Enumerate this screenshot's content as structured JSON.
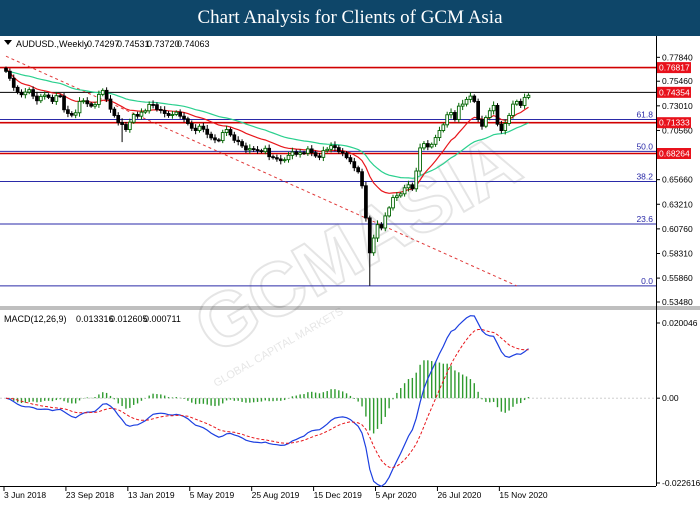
{
  "header": {
    "title": "Chart Analysis for Clients of GCM Asia"
  },
  "watermark": {
    "brand": "GCMASIA",
    "tagline": "GLOBAL CAPITAL MARKETS"
  },
  "colors": {
    "bullish": "#006400",
    "bearish": "#000000",
    "ema_fast": "#e8161b",
    "ema_slow": "#2ad08e",
    "sr_line": "#d10000",
    "fib_line": "#2a2aa8",
    "trendline": "#e03a3a",
    "macd_line": "#1c3fe0",
    "signal_line": "#e8161b",
    "histogram": "#2e9a2e",
    "price_label_bg": "#e8111b"
  },
  "chart_data": [
    {
      "type": "candlestick",
      "title": "AUDUSD.,Weekly",
      "ohlc": {
        "open": "0.74297",
        "high": "0.74531",
        "low": "0.73720",
        "close": "0.74063"
      },
      "x_labels": [
        "3 Jun 2018",
        "23 Sep 2018",
        "13 Jan 2019",
        "5 May 2019",
        "25 Aug 2019",
        "15 Dec 2019",
        "5 Apr 2020",
        "26 Jul 2020",
        "15 Nov 2020"
      ],
      "y_ticks": [
        "0.77840",
        "0.75460",
        "0.73010",
        "0.70560",
        "0.65660",
        "0.63210",
        "0.60760",
        "0.58310",
        "0.55860",
        "0.53480"
      ],
      "y_range": [
        0.5348,
        0.7837
      ],
      "resistance_levels": [
        {
          "value": 0.76817,
          "label": "0.76817"
        },
        {
          "value": 0.71333,
          "label": "0.71333"
        },
        {
          "value": 0.68264,
          "label": "0.68264"
        }
      ],
      "current_price": {
        "value": 0.74354,
        "label": "0.74354"
      },
      "fibonacci": [
        {
          "label": "61.8",
          "value": 0.7165
        },
        {
          "label": "50.0",
          "value": 0.6848
        },
        {
          "label": "38.2",
          "value": 0.6548
        },
        {
          "label": "23.6",
          "value": 0.6125
        },
        {
          "label": "0.0",
          "value": 0.5508
        }
      ],
      "trendline": {
        "from": {
          "x_index": 0,
          "y": 0.7795
        },
        "to": {
          "x_index": 132,
          "y": 0.5508
        }
      },
      "series": {
        "close": [
          0.7645,
          0.7575,
          0.7485,
          0.7435,
          0.7412,
          0.7438,
          0.7462,
          0.7398,
          0.7352,
          0.7395,
          0.7408,
          0.7385,
          0.7345,
          0.7402,
          0.7398,
          0.7262,
          0.7225,
          0.7208,
          0.7232,
          0.7345,
          0.7352,
          0.7322,
          0.7298,
          0.7315,
          0.7415,
          0.7455,
          0.7368,
          0.7268,
          0.7205,
          0.7135,
          0.7115,
          0.7065,
          0.7138,
          0.7215,
          0.7198,
          0.7238,
          0.7252,
          0.7315,
          0.7312,
          0.7265,
          0.7255,
          0.7225,
          0.7205,
          0.7215,
          0.7238,
          0.7198,
          0.7172,
          0.7125,
          0.7078,
          0.7055,
          0.7098,
          0.7068,
          0.7018,
          0.6982,
          0.6962,
          0.6955,
          0.7035,
          0.7065,
          0.7012,
          0.6958,
          0.6945,
          0.6902,
          0.6862,
          0.6875,
          0.6865,
          0.6855,
          0.6845,
          0.6878,
          0.6795,
          0.6785,
          0.6772,
          0.6755,
          0.6765,
          0.6808,
          0.6842,
          0.6818,
          0.6835,
          0.6828,
          0.6872,
          0.6835,
          0.6802,
          0.6788,
          0.6855,
          0.6868,
          0.6905,
          0.6885,
          0.6845,
          0.6832,
          0.6785,
          0.6745,
          0.6685,
          0.6645,
          0.6505,
          0.6185,
          0.5838,
          0.5985,
          0.6118,
          0.6085,
          0.6205,
          0.6285,
          0.6388,
          0.6405,
          0.6425,
          0.6485,
          0.6515,
          0.6475,
          0.6652,
          0.6882,
          0.6925,
          0.6892,
          0.6918,
          0.6985,
          0.7055,
          0.7112,
          0.7212,
          0.7235,
          0.7165,
          0.7298,
          0.7318,
          0.7365,
          0.7398,
          0.7345,
          0.7165,
          0.7098,
          0.7185,
          0.7252,
          0.7305,
          0.7118,
          0.7055,
          0.7125,
          0.7205,
          0.7318,
          0.7345,
          0.7305,
          0.7385,
          0.7406
        ],
        "ema_fast": [
          0.7676,
          0.7629,
          0.7586,
          0.7551,
          0.7526,
          0.7512,
          0.7503,
          0.7487,
          0.7468,
          0.7458,
          0.7451,
          0.7442,
          0.743,
          0.7426,
          0.7422,
          0.7401,
          0.7379,
          0.7359,
          0.7346,
          0.7346,
          0.7347,
          0.7344,
          0.7338,
          0.7335,
          0.7344,
          0.7356,
          0.7358,
          0.7348,
          0.7333,
          0.7312,
          0.7292,
          0.727,
          0.7258,
          0.7255,
          0.725,
          0.7249,
          0.7249,
          0.7256,
          0.7261,
          0.7262,
          0.7261,
          0.7257,
          0.7252,
          0.7248,
          0.7247,
          0.7242,
          0.7235,
          0.7224,
          0.7209,
          0.7194,
          0.7185,
          0.7174,
          0.7159,
          0.7142,
          0.7125,
          0.711,
          0.7102,
          0.7099,
          0.709,
          0.7076,
          0.7063,
          0.7047,
          0.7028,
          0.7013,
          0.6998,
          0.6983,
          0.697,
          0.6961,
          0.6945,
          0.693,
          0.6914,
          0.6898,
          0.6885,
          0.6878,
          0.6875,
          0.687,
          0.6867,
          0.6863,
          0.6864,
          0.6861,
          0.6855,
          0.6848,
          0.6848,
          0.6849,
          0.6855,
          0.6858,
          0.6857,
          0.6854,
          0.6845,
          0.6832,
          0.6812,
          0.679,
          0.6756,
          0.669,
          0.6598,
          0.6533,
          0.6493,
          0.6456,
          0.6438,
          0.643,
          0.6434,
          0.6437,
          0.6441,
          0.6453,
          0.6467,
          0.6472,
          0.6502,
          0.6563,
          0.6622,
          0.6667,
          0.6708,
          0.6754,
          0.6804,
          0.6852,
          0.6908,
          0.6959,
          0.6987,
          0.7034,
          0.7076,
          0.7121,
          0.7162,
          0.7186,
          0.7181,
          0.7167,
          0.7169,
          0.7183,
          0.7204,
          0.7189,
          0.7164,
          0.7157,
          0.7166,
          0.7192,
          0.7219,
          0.7235,
          0.7262,
          0.7287
        ],
        "ema_slow": [
          0.7646,
          0.7641,
          0.7632,
          0.7622,
          0.7611,
          0.7602,
          0.7596,
          0.7586,
          0.7574,
          0.7565,
          0.7557,
          0.7548,
          0.7537,
          0.7531,
          0.7524,
          0.751,
          0.7494,
          0.7479,
          0.7467,
          0.7461,
          0.7456,
          0.7449,
          0.7442,
          0.7435,
          0.7434,
          0.7435,
          0.7431,
          0.7423,
          0.7413,
          0.7399,
          0.7386,
          0.737,
          0.736,
          0.7354,
          0.7347,
          0.7342,
          0.7338,
          0.7337,
          0.7336,
          0.7333,
          0.7328,
          0.7323,
          0.7317,
          0.7312,
          0.7308,
          0.7302,
          0.7296,
          0.7286,
          0.7275,
          0.7263,
          0.7255,
          0.7245,
          0.7233,
          0.722,
          0.7207,
          0.7194,
          0.7186,
          0.718,
          0.7171,
          0.7159,
          0.7148,
          0.7135,
          0.712,
          0.7107,
          0.7094,
          0.7081,
          0.7069,
          0.7059,
          0.7044,
          0.7031,
          0.7017,
          0.7002,
          0.6989,
          0.698,
          0.6973,
          0.6965,
          0.6958,
          0.6951,
          0.6947,
          0.6941,
          0.6934,
          0.6926,
          0.6922,
          0.6919,
          0.6918,
          0.6916,
          0.6912,
          0.6908,
          0.6901,
          0.6891,
          0.6879,
          0.6865,
          0.6844,
          0.6807,
          0.6752,
          0.671,
          0.6678,
          0.6647,
          0.6625,
          0.661,
          0.6602,
          0.6594,
          0.6587,
          0.6585,
          0.6584,
          0.658,
          0.6585,
          0.6605,
          0.6624,
          0.664,
          0.6656,
          0.6676,
          0.6699,
          0.6724,
          0.6755,
          0.6784,
          0.6805,
          0.6834,
          0.6862,
          0.6891,
          0.692,
          0.6943,
          0.6957,
          0.6966,
          0.6979,
          0.6996,
          0.7014,
          0.7021,
          0.7024,
          0.7032,
          0.7045,
          0.7063,
          0.7082,
          0.7096,
          0.7114,
          0.713
        ]
      }
    },
    {
      "type": "line",
      "title": "MACD(12,26,9)",
      "header_values": [
        "0.013316",
        "0.012605",
        "0.000711"
      ],
      "y_ticks": [
        "0.020046",
        "0.00",
        "-0.022616"
      ],
      "y_range": [
        -0.022616,
        0.020046
      ],
      "x_labels": [
        "3 Jun 2018",
        "23 Sep 2018",
        "13 Jan 2019",
        "5 May 2019",
        "25 Aug 2019",
        "15 Dec 2019",
        "5 Apr 2020",
        "26 Jul 2020",
        "15 Nov 2020"
      ],
      "series": [
        {
          "values": [
            0.0,
            -0.0003,
            -0.0009,
            -0.0016,
            -0.0021,
            -0.0023,
            -0.0023,
            -0.0025,
            -0.0029,
            -0.003,
            -0.0029,
            -0.003,
            -0.0033,
            -0.0031,
            -0.003,
            -0.0036,
            -0.0043,
            -0.0049,
            -0.0052,
            -0.0045,
            -0.004,
            -0.0037,
            -0.0037,
            -0.0035,
            -0.0026,
            -0.0016,
            -0.0015,
            -0.0021,
            -0.0031,
            -0.0045,
            -0.0057,
            -0.0071,
            -0.0075,
            -0.0072,
            -0.0071,
            -0.0066,
            -0.006,
            -0.0051,
            -0.0043,
            -0.0041,
            -0.004,
            -0.0041,
            -0.0044,
            -0.0045,
            -0.0043,
            -0.0045,
            -0.0049,
            -0.0055,
            -0.0064,
            -0.0072,
            -0.0075,
            -0.0079,
            -0.0085,
            -0.0093,
            -0.0099,
            -0.0104,
            -0.0101,
            -0.0095,
            -0.0094,
            -0.0098,
            -0.0101,
            -0.0106,
            -0.0112,
            -0.0115,
            -0.0117,
            -0.0118,
            -0.0119,
            -0.0117,
            -0.0121,
            -0.0123,
            -0.0124,
            -0.0126,
            -0.0125,
            -0.0121,
            -0.0114,
            -0.011,
            -0.0105,
            -0.0101,
            -0.0092,
            -0.0087,
            -0.0085,
            -0.0084,
            -0.0077,
            -0.0069,
            -0.0059,
            -0.0053,
            -0.0051,
            -0.005,
            -0.0052,
            -0.0057,
            -0.0066,
            -0.0075,
            -0.0093,
            -0.0132,
            -0.019,
            -0.0222,
            -0.023,
            -0.0235,
            -0.0227,
            -0.0211,
            -0.0188,
            -0.0167,
            -0.0147,
            -0.0124,
            -0.0101,
            -0.0084,
            -0.0054,
            -0.0011,
            0.0026,
            0.0052,
            0.0074,
            0.0096,
            0.0118,
            0.0138,
            0.0161,
            0.0178,
            0.0183,
            0.0195,
            0.0205,
            0.0214,
            0.022,
            0.0219,
            0.02,
            0.018,
            0.017,
            0.0166,
            0.0165,
            0.0145,
            0.0124,
            0.0112,
            0.0109,
            0.0114,
            0.0118,
            0.0117,
            0.0124,
            0.0132
          ]
        },
        {
          "values": [
            0.0,
            -0.0001,
            -0.0002,
            -0.0005,
            -0.0008,
            -0.0011,
            -0.0013,
            -0.0016,
            -0.0018,
            -0.002,
            -0.0022,
            -0.0023,
            -0.0025,
            -0.0026,
            -0.0027,
            -0.0028,
            -0.0031,
            -0.0035,
            -0.0038,
            -0.0039,
            -0.0039,
            -0.0039,
            -0.0038,
            -0.0038,
            -0.0036,
            -0.0032,
            -0.0029,
            -0.0027,
            -0.0028,
            -0.0031,
            -0.0036,
            -0.0043,
            -0.0049,
            -0.0054,
            -0.0057,
            -0.0059,
            -0.0059,
            -0.0058,
            -0.0055,
            -0.0052,
            -0.005,
            -0.0048,
            -0.0047,
            -0.0047,
            -0.0046,
            -0.0046,
            -0.0047,
            -0.0048,
            -0.0052,
            -0.0056,
            -0.006,
            -0.0064,
            -0.0068,
            -0.0073,
            -0.0078,
            -0.0084,
            -0.0087,
            -0.0089,
            -0.009,
            -0.0091,
            -0.0094,
            -0.0096,
            -0.01,
            -0.0103,
            -0.0106,
            -0.0108,
            -0.011,
            -0.0111,
            -0.0113,
            -0.0115,
            -0.0117,
            -0.0119,
            -0.012,
            -0.012,
            -0.0119,
            -0.0117,
            -0.0115,
            -0.0112,
            -0.0108,
            -0.0104,
            -0.01,
            -0.0097,
            -0.0093,
            -0.0088,
            -0.0083,
            -0.0077,
            -0.0072,
            -0.0068,
            -0.0065,
            -0.0063,
            -0.0064,
            -0.0066,
            -0.0071,
            -0.0083,
            -0.0104,
            -0.0128,
            -0.0148,
            -0.0166,
            -0.0177,
            -0.0184,
            -0.0185,
            -0.0181,
            -0.0174,
            -0.0164,
            -0.0152,
            -0.0138,
            -0.0122,
            -0.01,
            -0.0075,
            -0.0049,
            -0.0025,
            -0.0001,
            0.0023,
            0.0046,
            0.0069,
            0.0091,
            0.0109,
            0.0126,
            0.0142,
            0.0156,
            0.0169,
            0.0179,
            0.0183,
            0.0183,
            0.018,
            0.0177,
            0.0175,
            0.0169,
            0.016,
            0.0151,
            0.0142,
            0.0137,
            0.0133,
            0.013,
            0.0129,
            0.0129
          ]
        },
        {
          "values": [
            0.0,
            -0.0002,
            -0.0007,
            -0.0011,
            -0.0013,
            -0.0012,
            -0.001,
            -0.0009,
            -0.0011,
            -0.001,
            -0.0007,
            -0.0007,
            -0.0008,
            -0.0005,
            -0.0003,
            -0.0008,
            -0.0012,
            -0.0014,
            -0.0014,
            -0.0006,
            -0.0001,
            0.0002,
            0.0001,
            0.0003,
            0.001,
            0.0016,
            0.0014,
            0.0006,
            -0.0003,
            -0.0014,
            -0.0021,
            -0.0028,
            -0.0026,
            -0.0018,
            -0.0014,
            -0.0007,
            -0.0001,
            0.0007,
            0.0012,
            0.0011,
            0.001,
            0.0007,
            0.0003,
            0.0002,
            0.0003,
            0.0001,
            -0.0002,
            -0.0007,
            -0.0012,
            -0.0016,
            -0.0015,
            -0.0015,
            -0.0017,
            -0.002,
            -0.0021,
            -0.002,
            -0.0014,
            -0.0006,
            -0.0004,
            -0.0007,
            -0.0007,
            -0.001,
            -0.0012,
            -0.0012,
            -0.0011,
            -0.001,
            -0.0009,
            -0.0006,
            -0.0008,
            -0.0008,
            -0.0007,
            -0.0007,
            -0.0005,
            -0.0001,
            0.0005,
            0.0007,
            0.001,
            0.0011,
            0.0016,
            0.0017,
            0.0015,
            0.0013,
            0.0016,
            0.0019,
            0.0024,
            0.0024,
            0.0021,
            0.0018,
            0.0013,
            0.0006,
            -0.0002,
            -0.0009,
            -0.0022,
            -0.0049,
            -0.0086,
            -0.0094,
            -0.0082,
            -0.0069,
            -0.005,
            -0.0027,
            -0.0003,
            0.0014,
            0.0027,
            0.004,
            0.0051,
            0.0054,
            0.0068,
            0.0089,
            0.0101,
            0.0101,
            0.0099,
            0.0097,
            0.0095,
            0.0092,
            0.0092,
            0.0087,
            0.0074,
            0.0069,
            0.0063,
            0.0058,
            0.0051,
            0.004,
            0.0017,
            -0.0003,
            -0.001,
            -0.0011,
            -0.001,
            -0.0024,
            -0.0036,
            -0.0039,
            -0.0033,
            -0.0023,
            -0.0015,
            -0.0013,
            -0.0005,
            0.0003
          ]
        }
      ]
    }
  ]
}
